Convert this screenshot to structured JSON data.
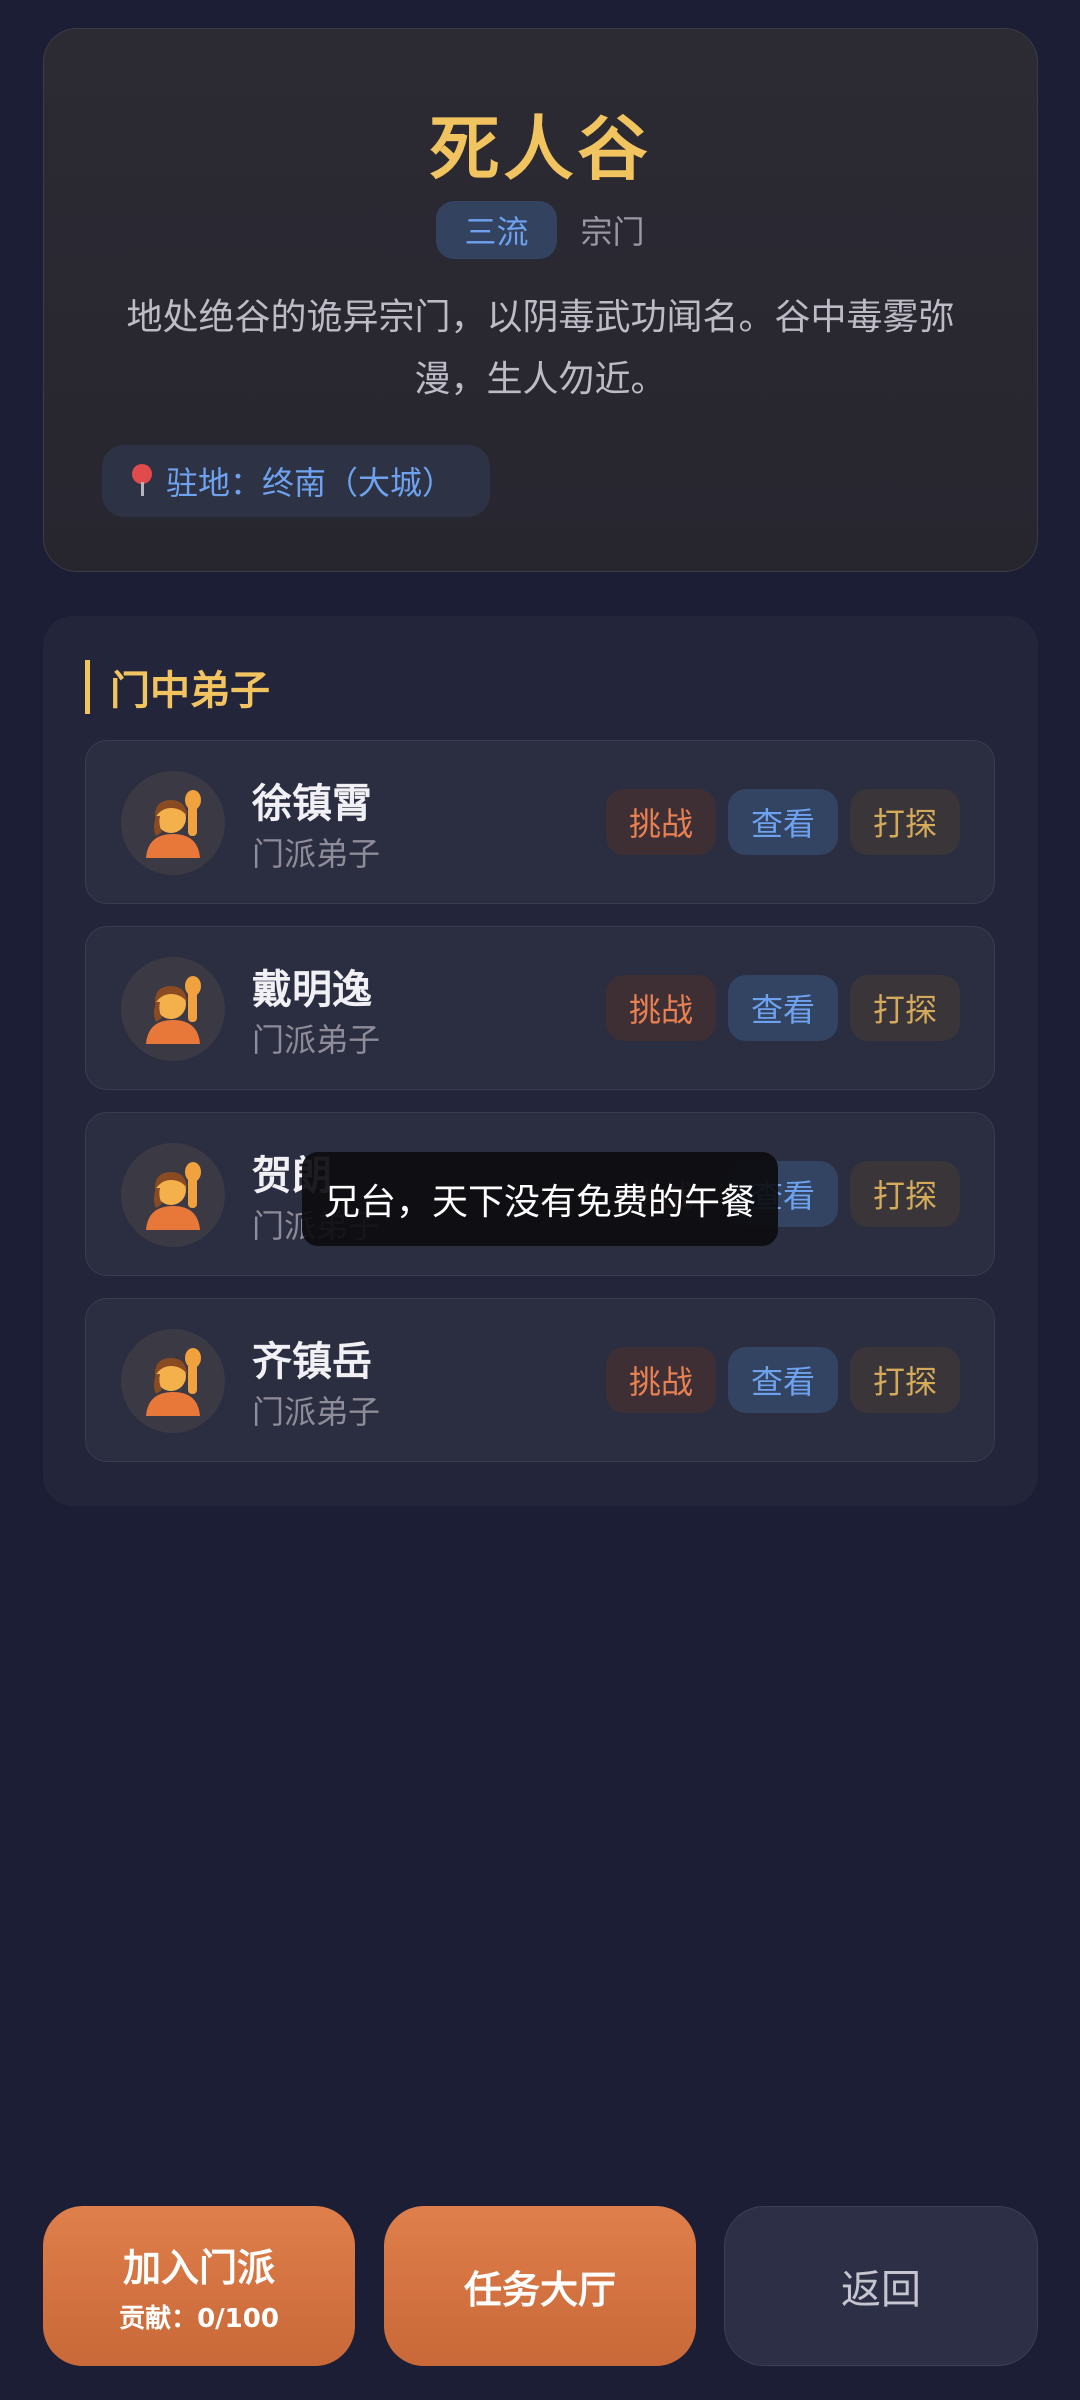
{
  "sect": {
    "title": "死人谷",
    "rank": "三流",
    "type": "宗门",
    "description": "地处绝谷的诡异宗门，以阴毒武功闻名。谷中毒雾弥漫，生人勿近。",
    "location": "驻地：终南（大城）"
  },
  "disciples": {
    "section_title": "门中弟子",
    "actions": {
      "challenge": "挑战",
      "view": "查看",
      "scout": "打探"
    },
    "members": [
      {
        "name": "徐镇霄",
        "role": "门派弟子",
        "avatar": "🙋"
      },
      {
        "name": "戴明逸",
        "role": "门派弟子",
        "avatar": "🙋"
      },
      {
        "name": "贺朗",
        "role": "门派弟子",
        "avatar": "🙋"
      },
      {
        "name": "齐镇岳",
        "role": "门派弟子",
        "avatar": "🙋"
      }
    ]
  },
  "toast": "兄台，天下没有免费的午餐",
  "bottom": {
    "join_label": "加入门派",
    "join_sub": "贡献：0/100",
    "task_label": "任务大厅",
    "back_label": "返回"
  },
  "colors": {
    "accent_gold": "#f2c45f",
    "accent_blue": "#6ea2ee",
    "accent_orange": "#df7f4b",
    "background": "#1b1e34"
  }
}
